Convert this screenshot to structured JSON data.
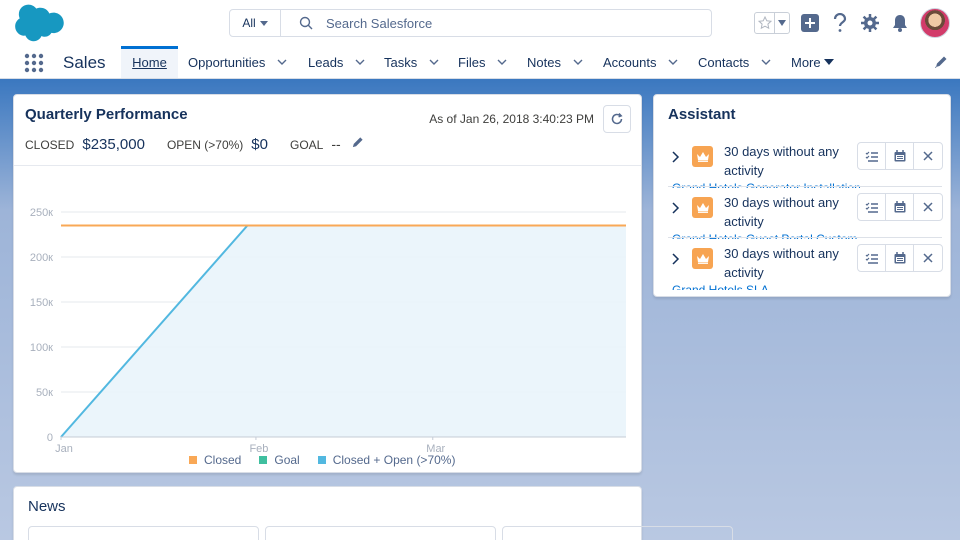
{
  "header": {
    "search_scope": "All",
    "search_placeholder": "Search Salesforce"
  },
  "nav": {
    "app_name": "Sales",
    "items": [
      {
        "label": "Home"
      },
      {
        "label": "Opportunities"
      },
      {
        "label": "Leads"
      },
      {
        "label": "Tasks"
      },
      {
        "label": "Files"
      },
      {
        "label": "Notes"
      },
      {
        "label": "Accounts"
      },
      {
        "label": "Contacts"
      },
      {
        "label": "More"
      }
    ]
  },
  "performance": {
    "title": "Quarterly Performance",
    "as_of": "As of Jan 26, 2018 3:40:23 PM",
    "closed_label": "CLOSED",
    "closed_value": "$235,000",
    "open_label": "OPEN (>70%)",
    "open_value": "$0",
    "goal_label": "GOAL",
    "goal_value": "--"
  },
  "chart_data": {
    "type": "line",
    "title": "",
    "y_ticks": [
      "0",
      "50к",
      "100к",
      "150к",
      "200к",
      "250к"
    ],
    "x_ticks": [
      "Jan",
      "Feb",
      "Mar"
    ],
    "ylim": [
      0,
      250000
    ],
    "series": [
      {
        "name": "Closed",
        "color": "#f9a856",
        "points": [
          [
            0,
            235000
          ],
          [
            1,
            235000
          ]
        ]
      },
      {
        "name": "Goal",
        "color": "#3fbf9f",
        "points": []
      },
      {
        "name": "Closed + Open (>70%)",
        "color": "#52b8e0",
        "points": [
          [
            0,
            0
          ],
          [
            0.33,
            235000
          ],
          [
            1,
            235000
          ]
        ]
      }
    ],
    "grid": true,
    "legend": "bottom"
  },
  "assistant": {
    "title": "Assistant",
    "items": [
      {
        "text": "30 days without any activity",
        "link": "Grand Hotels Generator Installation"
      },
      {
        "text": "30 days without any activity",
        "link": "Grand Hotels Guest Portal Custom"
      },
      {
        "text": "30 days without any activity",
        "link": "Grand Hotels SLA"
      }
    ]
  },
  "news": {
    "title": "News"
  }
}
